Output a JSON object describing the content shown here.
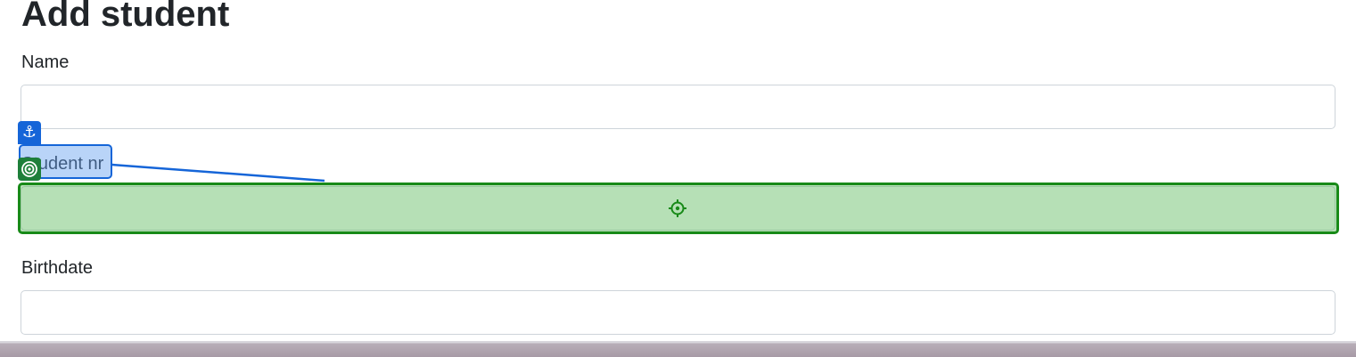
{
  "page": {
    "title": "Add student"
  },
  "form": {
    "name": {
      "label": "Name",
      "value": ""
    },
    "student_nr": {
      "label": "Student nr",
      "value": ""
    },
    "birthdate": {
      "label": "Birthdate",
      "value": ""
    }
  },
  "overlay": {
    "source_color": "#1565d8",
    "target_color": "#188a18",
    "anchor_icon": "anchor-icon",
    "target_icon": "target-icon",
    "crosshair_icon": "crosshair-icon"
  }
}
